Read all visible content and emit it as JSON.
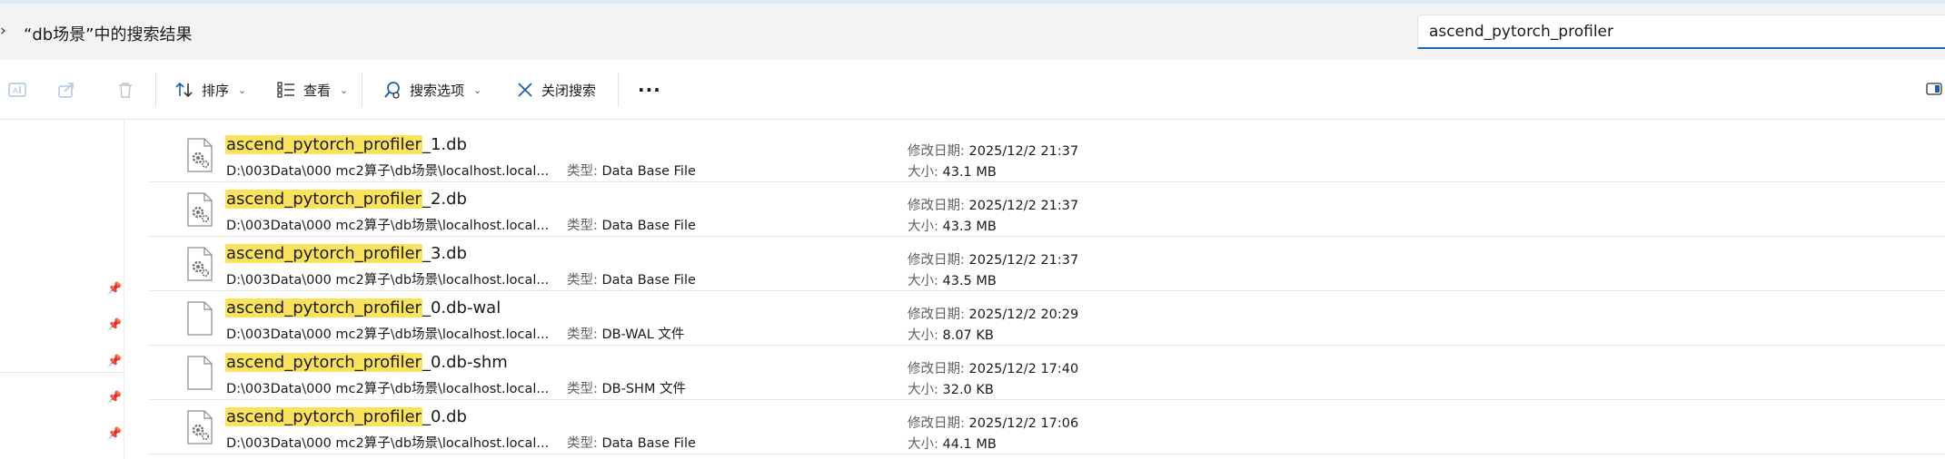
{
  "address": {
    "chevron": "›",
    "text": "“db场景”中的搜索结果"
  },
  "search": {
    "value": "ascend_pytorch_profiler"
  },
  "toolbar": {
    "sort_label": "排序",
    "view_label": "查看",
    "search_options_label": "搜索选项",
    "close_search_label": "关闭搜索",
    "more_label": "···"
  },
  "labels": {
    "type": "类型: ",
    "date": "修改日期: ",
    "size": "大小: "
  },
  "files": [
    {
      "highlight": "ascend_pytorch_profiler",
      "suffix": "_1.db",
      "path": "D:\\003Data\\000 mc2算子\\db场景\\localhost.local...",
      "type": "Data Base File",
      "date": "2025/12/2 21:37",
      "size": "43.1 MB",
      "icon": "settings-file-icon"
    },
    {
      "highlight": "ascend_pytorch_profiler",
      "suffix": "_2.db",
      "path": "D:\\003Data\\000 mc2算子\\db场景\\localhost.local...",
      "type": "Data Base File",
      "date": "2025/12/2 21:37",
      "size": "43.3 MB",
      "icon": "settings-file-icon"
    },
    {
      "highlight": "ascend_pytorch_profiler",
      "suffix": "_3.db",
      "path": "D:\\003Data\\000 mc2算子\\db场景\\localhost.local...",
      "type": "Data Base File",
      "date": "2025/12/2 21:37",
      "size": "43.5 MB",
      "icon": "settings-file-icon"
    },
    {
      "highlight": "ascend_pytorch_profiler",
      "suffix": "_0.db-wal",
      "path": "D:\\003Data\\000 mc2算子\\db场景\\localhost.local...",
      "type": "DB-WAL 文件",
      "date": "2025/12/2 20:29",
      "size": "8.07 KB",
      "icon": "blank-file-icon"
    },
    {
      "highlight": "ascend_pytorch_profiler",
      "suffix": "_0.db-shm",
      "path": "D:\\003Data\\000 mc2算子\\db场景\\localhost.local...",
      "type": "DB-SHM 文件",
      "date": "2025/12/2 17:40",
      "size": "32.0 KB",
      "icon": "blank-file-icon"
    },
    {
      "highlight": "ascend_pytorch_profiler",
      "suffix": "_0.db",
      "path": "D:\\003Data\\000 mc2算子\\db场景\\localhost.local...",
      "type": "Data Base File",
      "date": "2025/12/2 17:06",
      "size": "44.1 MB",
      "icon": "settings-file-icon"
    }
  ],
  "pins": [
    "pin-icon",
    "pin-icon",
    "pin-icon",
    "pin-icon",
    "pin-icon"
  ]
}
